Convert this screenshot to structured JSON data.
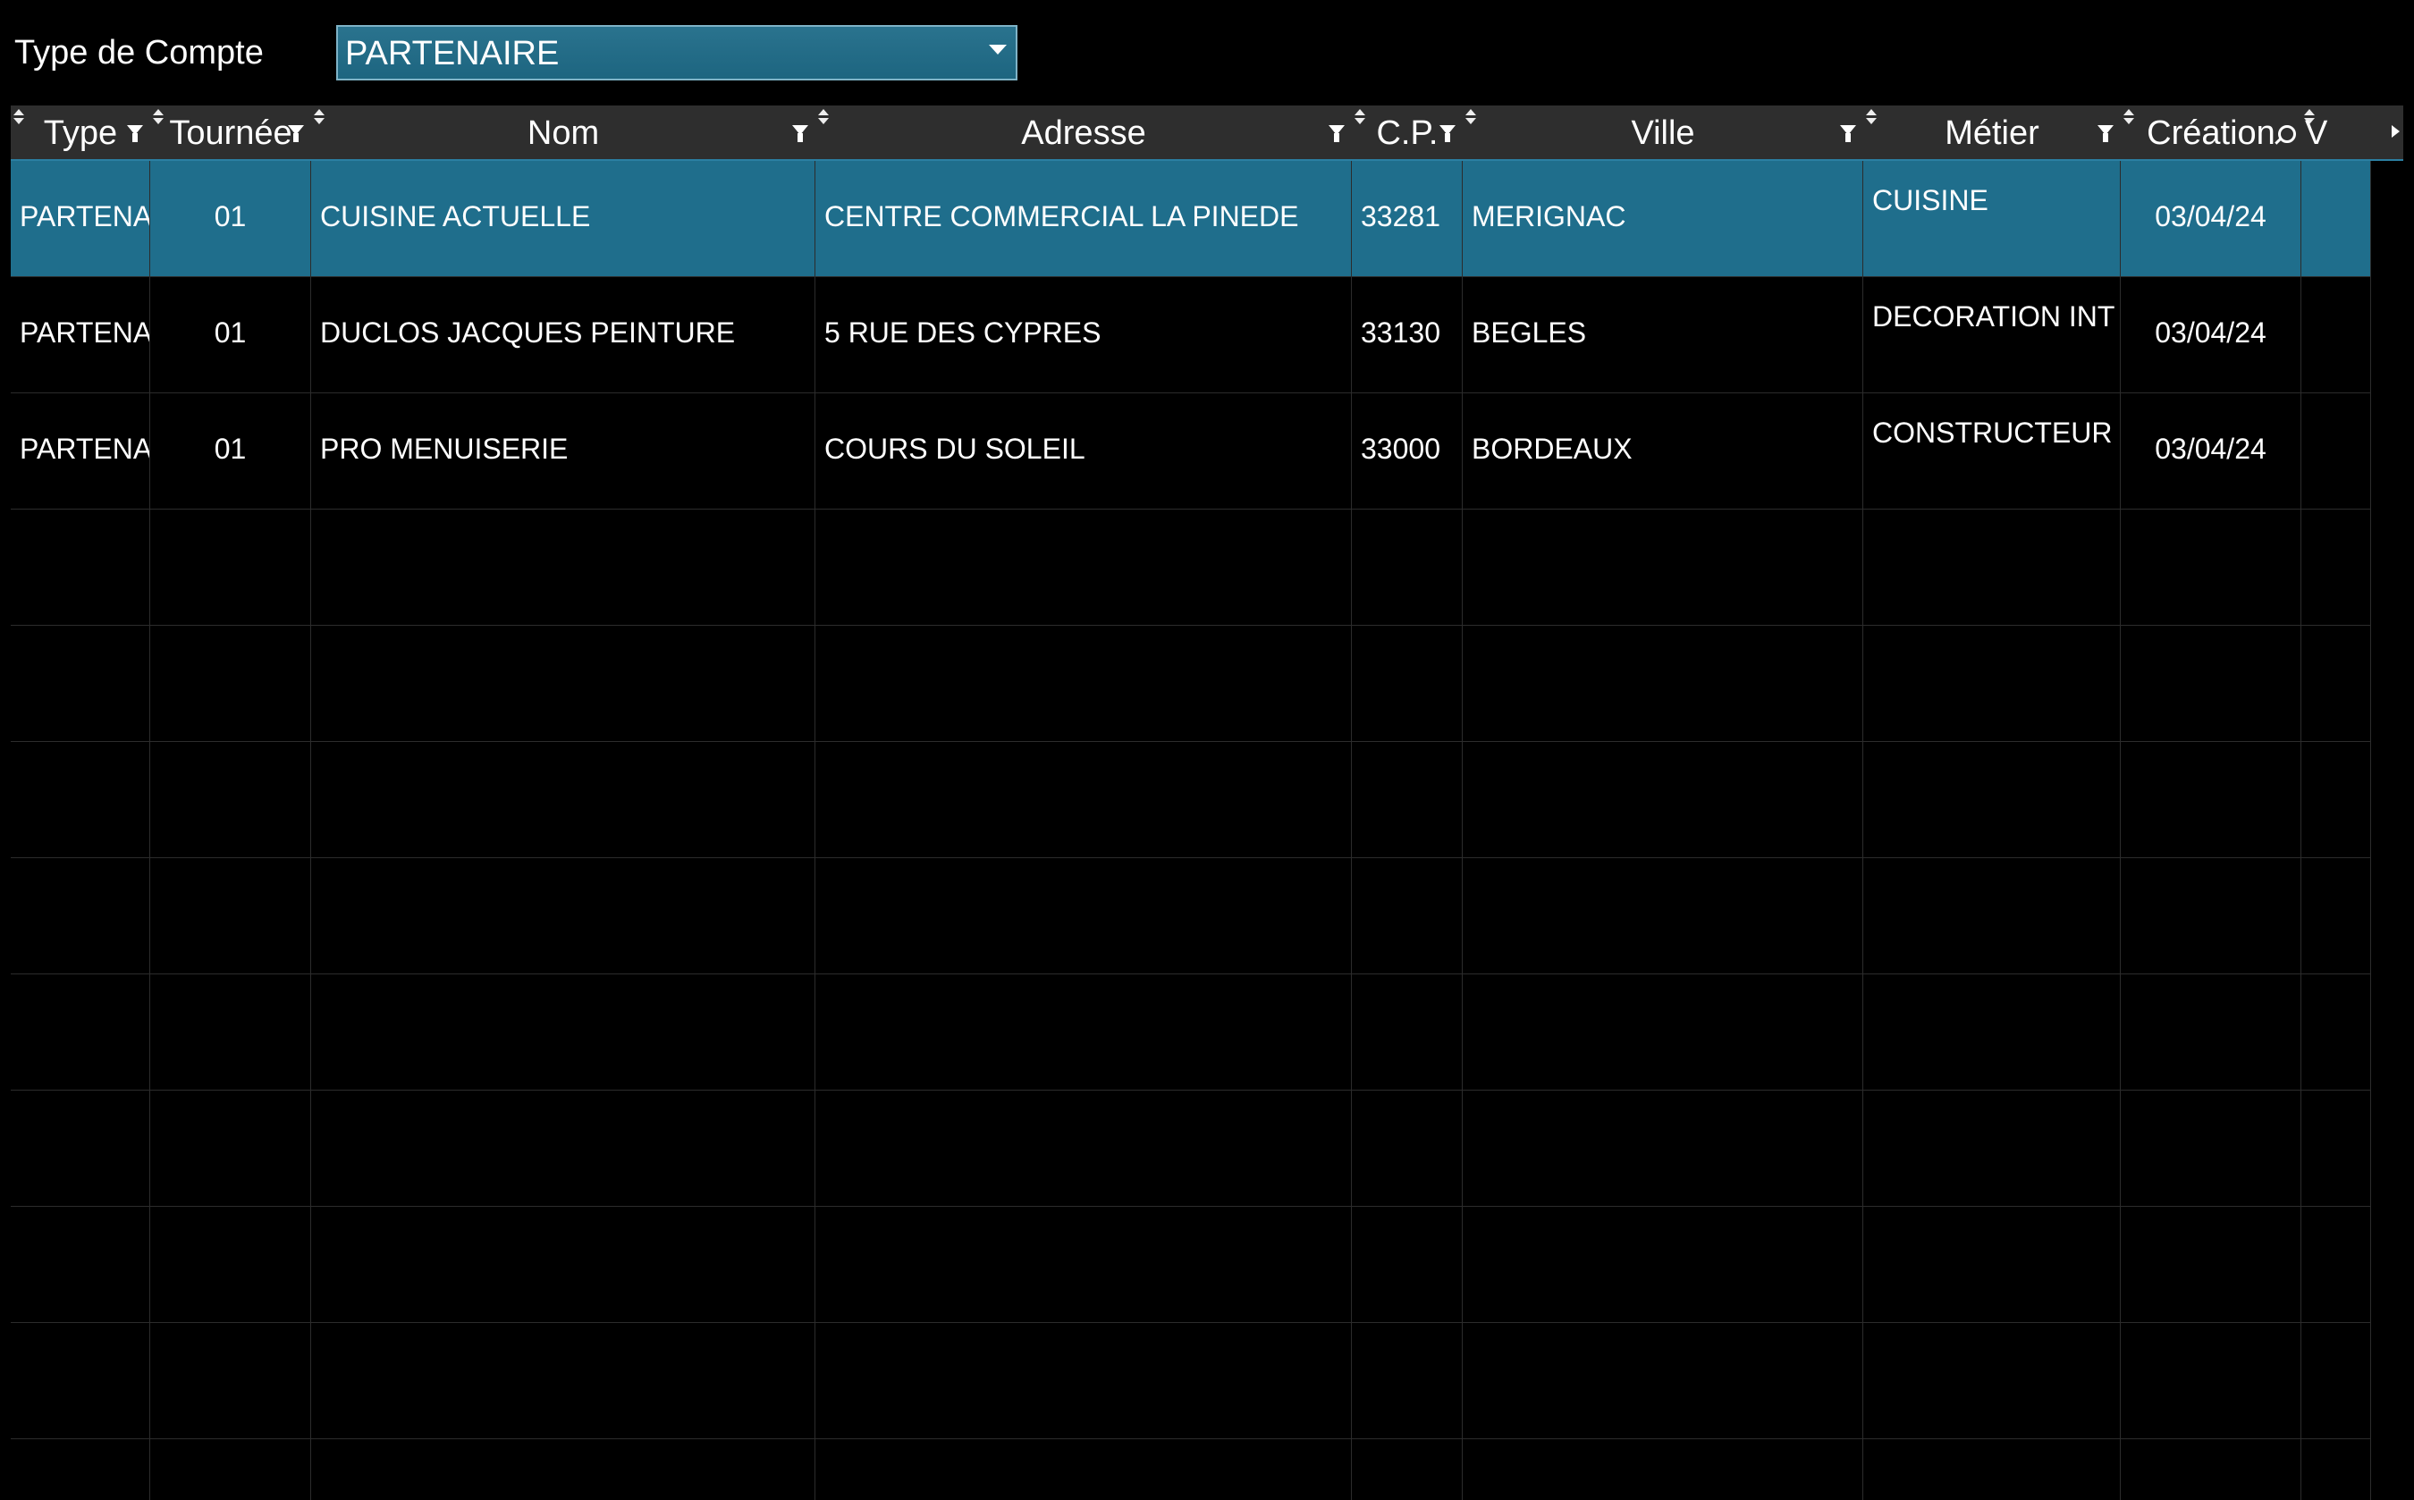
{
  "filter": {
    "label": "Type de Compte",
    "selected": "PARTENAIRE"
  },
  "grid": {
    "columns": [
      {
        "key": "type",
        "label": "Type",
        "control": "filter"
      },
      {
        "key": "tournee",
        "label": "Tournée",
        "control": "filter"
      },
      {
        "key": "nom",
        "label": "Nom",
        "control": "filter"
      },
      {
        "key": "adresse",
        "label": "Adresse",
        "control": "filter"
      },
      {
        "key": "cp",
        "label": "C.P.",
        "control": "filter"
      },
      {
        "key": "ville",
        "label": "Ville",
        "control": "filter"
      },
      {
        "key": "metier",
        "label": "Métier",
        "control": "filter"
      },
      {
        "key": "creation",
        "label": "Création",
        "control": "search"
      },
      {
        "key": "v",
        "label": "V",
        "control": "scroll"
      }
    ],
    "rows": [
      {
        "type": "PARTENAIRE",
        "tournee": "01",
        "nom": "CUISINE ACTUELLE",
        "adresse": "CENTRE COMMERCIAL LA PINEDE",
        "cp": "33281",
        "ville": "MERIGNAC",
        "metier": "CUISINE",
        "creation": "03/04/24",
        "selected": true
      },
      {
        "type": "PARTENAIRE",
        "tournee": "01",
        "nom": "DUCLOS JACQUES PEINTURE",
        "adresse": "5 RUE DES CYPRES",
        "cp": "33130",
        "ville": "BEGLES",
        "metier": "DECORATION INT",
        "creation": "03/04/24",
        "selected": false
      },
      {
        "type": "PARTENAIRE",
        "tournee": "01",
        "nom": "PRO MENUISERIE",
        "adresse": "COURS DU SOLEIL",
        "cp": "33000",
        "ville": "BORDEAUX",
        "metier": "CONSTRUCTEUR",
        "creation": "03/04/24",
        "selected": false
      }
    ],
    "empty_rows": 9
  },
  "icons": {
    "sort": "sort-icon",
    "filter": "funnel-icon",
    "search": "magnifier-icon",
    "dropdown": "chevron-down-icon",
    "scroll": "arrow-right-icon"
  },
  "colors": {
    "background": "#000000",
    "header": "#2e2e2e",
    "selection": "#1f6e8c",
    "accent": "#2b7fa2"
  }
}
